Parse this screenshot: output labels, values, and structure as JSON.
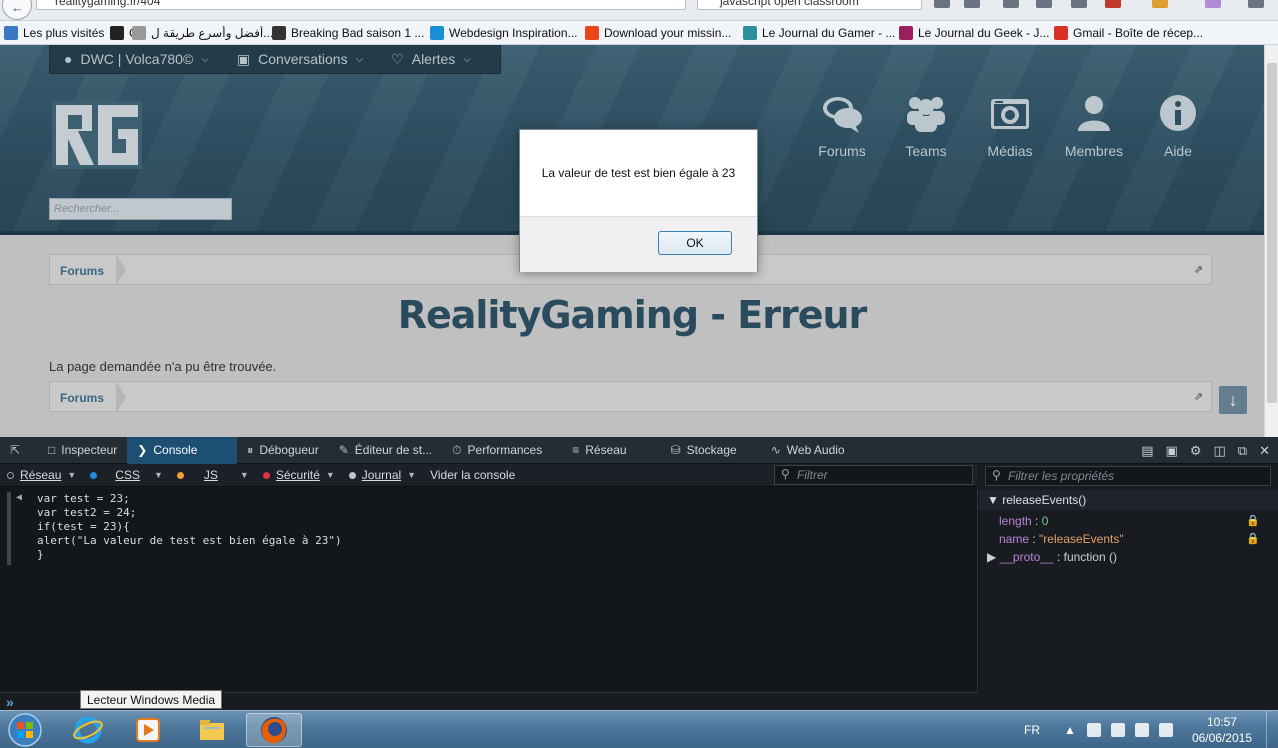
{
  "browser": {
    "url": "realitygaming.fr/404",
    "search": "javascript open classroom"
  },
  "bookmarks": [
    {
      "label": "Les plus visités",
      "icon": "globe-icon",
      "color": "#3a78c2"
    },
    {
      "label": "C",
      "icon": "c-letter-icon",
      "color": "#222222"
    },
    {
      "label": "أفضل وأسرع طريقة ل...",
      "icon": "generic-page-icon",
      "color": "#999999"
    },
    {
      "label": "Breaking Bad saison 1 ...",
      "icon": "spider-icon",
      "color": "#333333"
    },
    {
      "label": "Webdesign Inspiration...",
      "icon": "webdesign-icon",
      "color": "#1a8fd6"
    },
    {
      "label": "Download your missin...",
      "icon": "gear-icon",
      "color": "#e8451b"
    },
    {
      "label": "Le Journal du Gamer - ...",
      "icon": "gamer-icon",
      "color": "#2b8f9c"
    },
    {
      "label": "Le Journal du Geek - J...",
      "icon": "geek-icon",
      "color": "#9b1e5e"
    },
    {
      "label": "Gmail - Boîte de récep...",
      "icon": "gmail-icon",
      "color": "#d93025"
    }
  ],
  "site": {
    "topnav": [
      {
        "label": "DWC | Volca780©",
        "icon": "user-icon"
      },
      {
        "label": "Conversations",
        "icon": "inbox-icon"
      },
      {
        "label": "Alertes",
        "icon": "bell-icon"
      }
    ],
    "search_placeholder": "Rechercher...",
    "nav": [
      {
        "label": "Forums",
        "icon": "chat-bubbles-icon"
      },
      {
        "label": "Teams",
        "icon": "group-icon"
      },
      {
        "label": "Médias",
        "icon": "camera-icon"
      },
      {
        "label": "Membres",
        "icon": "person-icon"
      },
      {
        "label": "Aide",
        "icon": "info-icon"
      }
    ],
    "breadcrumb": "Forums",
    "page_title": "RealityGaming - Erreur",
    "message": "La page demandée n'a pu être trouvée."
  },
  "dialog": {
    "message": "La valeur de test est bien égale à 23",
    "ok_label": "OK"
  },
  "devtools": {
    "tabs": [
      {
        "label": "Inspecteur",
        "icon": "inspector-icon"
      },
      {
        "label": "Console",
        "icon": "console-icon"
      },
      {
        "label": "Débogueur",
        "icon": "debugger-icon"
      },
      {
        "label": "Éditeur de st...",
        "icon": "style-editor-icon"
      },
      {
        "label": "Performances",
        "icon": "performance-icon"
      },
      {
        "label": "Réseau",
        "icon": "network-icon"
      },
      {
        "label": "Stockage",
        "icon": "storage-icon"
      },
      {
        "label": "Web Audio",
        "icon": "web-audio-icon"
      }
    ],
    "filters": [
      {
        "label": "Réseau",
        "color": "#1b1f24"
      },
      {
        "label": "CSS",
        "color": "#1e8be0"
      },
      {
        "label": "JS",
        "color": "#f0a033"
      },
      {
        "label": "Sécurité",
        "color": "#e0324b"
      },
      {
        "label": "Journal",
        "color": "#bfc6cc"
      }
    ],
    "clear_label": "Vider la console",
    "filter_placeholder": "Filtrer",
    "console_code": "var test = 23;\nvar test2 = 24;\nif(test = 23){\nalert(\"La valeur de test est bien égale à 23\")\n}",
    "props_filter_placeholder": "Filtrer les propriétés",
    "props_head": "releaseEvents()",
    "props": [
      {
        "key": "length",
        "value": "0",
        "type": "number"
      },
      {
        "key": "name",
        "value": "\"releaseEvents\"",
        "type": "string"
      },
      {
        "key": "__proto__",
        "value": "function ()",
        "type": "function"
      }
    ]
  },
  "taskbar": {
    "tooltip": "Lecteur Windows Media",
    "lang": "FR",
    "time": "10:57",
    "date": "06/06/2015"
  }
}
